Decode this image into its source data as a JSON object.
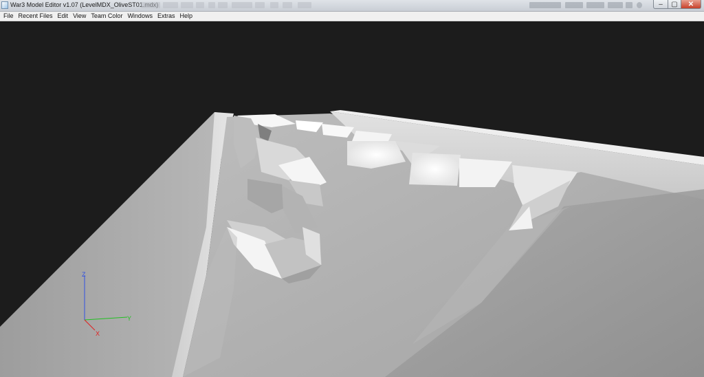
{
  "window": {
    "title": "War3 Model Editor v1.07 (LevelMDX_OliveST01.mdx)",
    "controls": {
      "minimize": "–",
      "maximize": "▢",
      "close": "✕"
    }
  },
  "menu": {
    "items": [
      "File",
      "Recent Files",
      "Edit",
      "View",
      "Team Color",
      "Windows",
      "Extras",
      "Help"
    ]
  },
  "viewport": {
    "background": "#1c1c1c",
    "axes": {
      "x": {
        "label": "X",
        "color": "#e02020"
      },
      "y": {
        "label": "Y",
        "color": "#20c020"
      },
      "z": {
        "label": "Z",
        "color": "#3050e0"
      }
    }
  }
}
